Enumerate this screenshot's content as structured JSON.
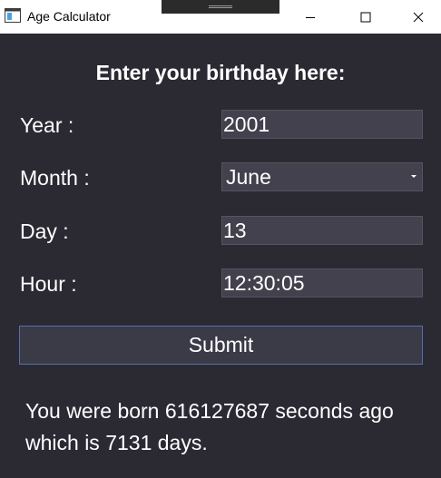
{
  "window": {
    "title": "Age Calculator",
    "minimize_icon": "minimize-icon",
    "maximize_icon": "maximize-icon",
    "close_icon": "close-icon"
  },
  "form": {
    "heading": "Enter your birthday here:",
    "year_label": "Year :",
    "year_value": "2001",
    "month_label": "Month :",
    "month_value": "June",
    "day_label": "Day :",
    "day_value": "13",
    "hour_label": "Hour :",
    "hour_value": "12:30:05",
    "submit_label": "Submit"
  },
  "result": {
    "line1": "You were born 616127687 seconds ago",
    "line2": "which is 7131 days."
  },
  "colors": {
    "background": "#2b2a33",
    "input_background": "#42414d",
    "button_background": "#3b3a47",
    "button_border": "#5470b0",
    "text": "#ffffff"
  }
}
